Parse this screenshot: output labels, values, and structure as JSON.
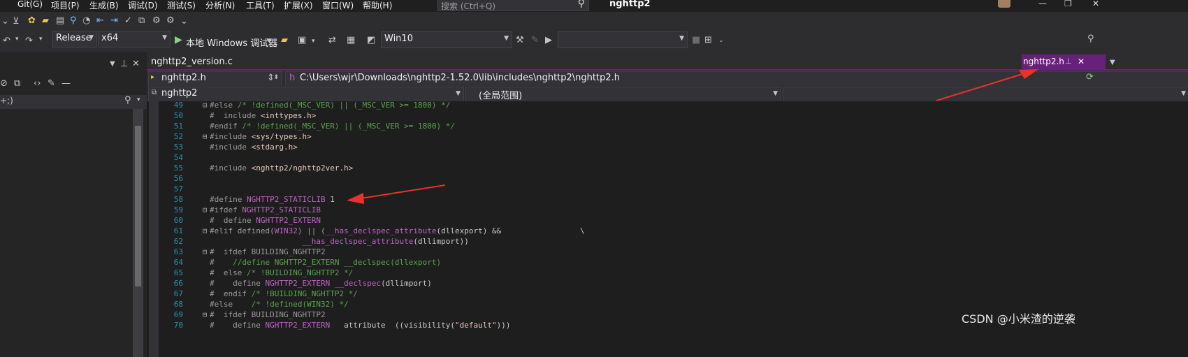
{
  "menu": [
    "Git(G)",
    "项目(P)",
    "生成(B)",
    "调试(D)",
    "测试(S)",
    "分析(N)",
    "工具(T)",
    "扩展(X)",
    "窗口(W)",
    "帮助(H)"
  ],
  "search": {
    "placeholder": "搜索 (Ctrl+Q)"
  },
  "solution_title": "nghttp2",
  "toolbar": {
    "config": "Release",
    "platform": "x64",
    "debugger": "本地 Windows 调试器",
    "target_os": "Win10"
  },
  "left_pane": {
    "search_text": "+;)"
  },
  "tabs": {
    "inactive": "nghttp2_version.c",
    "active": "nghttp2.h"
  },
  "nav": {
    "file_combo": "nghttp2.h",
    "path": "C:\\Users\\wjr\\Downloads\\nghttp2-1.52.0\\lib\\includes\\nghttp2\\nghttp2.h",
    "project": "nghttp2",
    "scope": "(全局范围)",
    "path_prefix": "h"
  },
  "code": [
    {
      "n": "49",
      "fold": "⊟",
      "parts": [
        [
          "k",
          "#else "
        ],
        [
          "c",
          "/* !defined(_MSC_VER) || (_MSC_VER >= 1800) */"
        ]
      ]
    },
    {
      "n": "50",
      "fold": "",
      "parts": [
        [
          "k",
          "#  include "
        ],
        [
          "s",
          "<inttypes.h>"
        ]
      ]
    },
    {
      "n": "51",
      "fold": "",
      "parts": [
        [
          "k",
          "#endif "
        ],
        [
          "c",
          "/* !defined(_MSC_VER) || (_MSC_VER >= 1800) */"
        ]
      ]
    },
    {
      "n": "52",
      "fold": "⊟",
      "parts": [
        [
          "k",
          "#include "
        ],
        [
          "s",
          "<sys/types.h>"
        ]
      ]
    },
    {
      "n": "53",
      "fold": "",
      "parts": [
        [
          "k",
          "#include "
        ],
        [
          "s",
          "<stdarg.h>"
        ]
      ]
    },
    {
      "n": "54",
      "fold": "",
      "parts": []
    },
    {
      "n": "55",
      "fold": "",
      "parts": [
        [
          "k",
          "#include "
        ],
        [
          "s",
          "<nghttp2/nghttp2ver.h>"
        ]
      ]
    },
    {
      "n": "56",
      "fold": "",
      "parts": []
    },
    {
      "n": "57",
      "fold": "",
      "parts": []
    },
    {
      "n": "58",
      "fold": "",
      "parts": [
        [
          "k",
          "#define "
        ],
        [
          "m",
          "NGHTTP2_STATICLIB"
        ],
        [
          "t",
          " 1"
        ]
      ]
    },
    {
      "n": "59",
      "fold": "⊟",
      "parts": [
        [
          "k",
          "#ifdef "
        ],
        [
          "m",
          "NGHTTP2_STATICLIB"
        ]
      ]
    },
    {
      "n": "60",
      "fold": "",
      "parts": [
        [
          "k",
          "#  define "
        ],
        [
          "m",
          "NGHTTP2_EXTERN"
        ]
      ]
    },
    {
      "n": "61",
      "fold": "⊟",
      "parts": [
        [
          "k",
          "#elif defined("
        ],
        [
          "m",
          "WIN32"
        ],
        [
          "k",
          ") || ("
        ],
        [
          "m",
          "__has_declspec_attribute"
        ],
        [
          "t",
          "(dllexport) &&                 \\"
        ]
      ]
    },
    {
      "n": "62",
      "fold": "",
      "parts": [
        [
          "t",
          "                    "
        ],
        [
          "m",
          "__has_declspec_attribute"
        ],
        [
          "t",
          "(dllimport))"
        ]
      ]
    },
    {
      "n": "63",
      "fold": "⊟",
      "parts": [
        [
          "k",
          "#  ifdef BUILDING_NGHTTP2"
        ]
      ]
    },
    {
      "n": "64",
      "fold": "",
      "parts": [
        [
          "k",
          "#    "
        ],
        [
          "c",
          "//define NGHTTP2_EXTERN __declspec(dllexport)"
        ]
      ]
    },
    {
      "n": "65",
      "fold": "",
      "parts": [
        [
          "k",
          "#  else "
        ],
        [
          "c",
          "/* !BUILDING_NGHTTP2 */"
        ]
      ]
    },
    {
      "n": "66",
      "fold": "",
      "parts": [
        [
          "k",
          "#    define "
        ],
        [
          "m",
          "NGHTTP2_EXTERN"
        ],
        [
          "t",
          " "
        ],
        [
          "m",
          "__declspec"
        ],
        [
          "t",
          "(dllimport)"
        ]
      ]
    },
    {
      "n": "67",
      "fold": "",
      "parts": [
        [
          "k",
          "#  endif "
        ],
        [
          "c",
          "/* !BUILDING_NGHTTP2 */"
        ]
      ]
    },
    {
      "n": "68",
      "fold": "",
      "parts": [
        [
          "k",
          "#else    "
        ],
        [
          "c",
          "/* !defined(WIN32) */"
        ]
      ]
    },
    {
      "n": "69",
      "fold": "⊟",
      "parts": [
        [
          "k",
          "#  ifdef BUILDING_NGHTTP2"
        ]
      ]
    },
    {
      "n": "70",
      "fold": "",
      "parts": [
        [
          "k",
          "#    define "
        ],
        [
          "m",
          "NGHTTP2_EXTERN"
        ],
        [
          "t",
          "   attribute  ((visibility("
        ],
        [
          "s",
          "\"default\""
        ],
        [
          "t",
          ")))"
        ]
      ]
    }
  ],
  "watermark": "CSDN @小米渣的逆袭",
  "colors": {
    "accent": "#68217a",
    "arrow": "#e8322b"
  }
}
